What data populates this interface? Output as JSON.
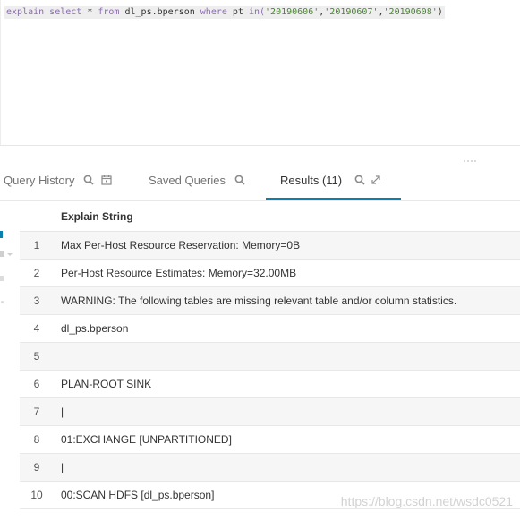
{
  "editor": {
    "tokens": [
      {
        "t": "explain ",
        "c": "kw"
      },
      {
        "t": "select ",
        "c": "kw"
      },
      {
        "t": "* ",
        "c": "plain"
      },
      {
        "t": "from ",
        "c": "kw"
      },
      {
        "t": "dl_ps.bperson ",
        "c": "plain"
      },
      {
        "t": "where ",
        "c": "kw"
      },
      {
        "t": "pt ",
        "c": "plain"
      },
      {
        "t": "in(",
        "c": "kw"
      },
      {
        "t": "'20190606'",
        "c": "str"
      },
      {
        "t": ",",
        "c": "plain"
      },
      {
        "t": "'20190607'",
        "c": "str"
      },
      {
        "t": ",",
        "c": "plain"
      },
      {
        "t": "'20190608'",
        "c": "str"
      },
      {
        "t": ")",
        "c": "plain"
      }
    ]
  },
  "tabs": {
    "query_history": "Query History",
    "saved_queries": "Saved Queries",
    "results": "Results (11)"
  },
  "results": {
    "column_header": "Explain String",
    "rows": [
      {
        "n": "1",
        "text": "Max Per-Host Resource Reservation: Memory=0B"
      },
      {
        "n": "2",
        "text": "Per-Host Resource Estimates: Memory=32.00MB"
      },
      {
        "n": "3",
        "text": "WARNING: The following tables are missing relevant table and/or column statistics."
      },
      {
        "n": "4",
        "text": "dl_ps.bperson"
      },
      {
        "n": "5",
        "text": ""
      },
      {
        "n": "6",
        "text": "PLAN-ROOT SINK"
      },
      {
        "n": "7",
        "text": "|"
      },
      {
        "n": "8",
        "text": "01:EXCHANGE [UNPARTITIONED]"
      },
      {
        "n": "9",
        "text": "|"
      },
      {
        "n": "10",
        "text": "00:SCAN HDFS [dl_ps.bperson]"
      }
    ]
  },
  "watermark": "https://blog.csdn.net/wsdc0521",
  "colors": {
    "accent": "#0b7fad",
    "keyword": "#8c6bb1",
    "string": "#468a2a"
  },
  "icons": [
    "search-icon",
    "calendar-icon",
    "expand-icon"
  ]
}
